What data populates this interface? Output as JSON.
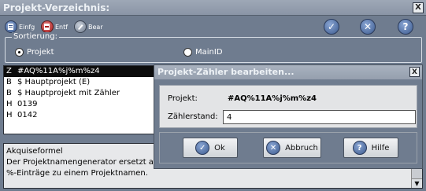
{
  "window": {
    "title": "Projekt-Verzeichnis:",
    "close_glyph": "X"
  },
  "toolbar": {
    "insert_label": "Einfg",
    "delete_label": "Entf",
    "edit_label": "Bear",
    "ok_glyph": "✓",
    "cancel_glyph": "✕",
    "help_glyph": "?"
  },
  "sort": {
    "legend": "Sortierung:",
    "options": [
      {
        "label": "Projekt",
        "selected": true
      },
      {
        "label": "MainID",
        "selected": false
      }
    ]
  },
  "list": {
    "items": [
      {
        "type": "Z",
        "name": "#AQ%11A%j%m%z4",
        "selected": true
      },
      {
        "type": "B",
        "name": "$ Hauptprojekt (E)",
        "selected": false
      },
      {
        "type": "B",
        "name": "$ Hauptprojekt mit Zähler",
        "selected": false
      },
      {
        "type": "H",
        "name": "0139",
        "selected": false
      },
      {
        "type": "H",
        "name": "0142",
        "selected": false
      }
    ]
  },
  "description": {
    "lines": [
      "Akquiseformel",
      "Der Projektnamengenerator ersetzt alle",
      "%-Einträge zu einem Projektnamen."
    ]
  },
  "dialog": {
    "title": "Projekt-Zähler bearbeiten...",
    "close_glyph": "X",
    "project_label": "Projekt:",
    "project_value": "#AQ%11A%j%m%z4",
    "counter_label": "Zählerstand:",
    "counter_value": "4",
    "ok_label": "Ok",
    "cancel_label": "Abbruch",
    "help_label": "Hilfe"
  },
  "colors": {
    "background": "#6f7c8f",
    "selection": "#0c0c0c",
    "accent_icon": "#3c5a8e"
  }
}
